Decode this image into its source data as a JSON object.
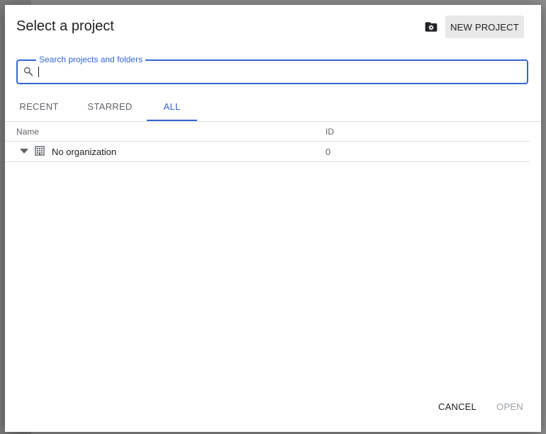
{
  "dialog": {
    "title": "Select a project",
    "new_project_label": "NEW PROJECT"
  },
  "search": {
    "label": "Search projects and folders",
    "value": ""
  },
  "tabs": [
    {
      "label": "RECENT",
      "active": false
    },
    {
      "label": "STARRED",
      "active": false
    },
    {
      "label": "ALL",
      "active": true
    }
  ],
  "table": {
    "columns": [
      "Name",
      "ID"
    ],
    "rows": [
      {
        "name": "No organization",
        "id": "0",
        "icon": "organization-icon",
        "expand_icon": "caret-down-icon"
      }
    ]
  },
  "footer": {
    "cancel_label": "CANCEL",
    "open_label": "OPEN"
  },
  "colors": {
    "accent": "#3367d6",
    "button_bg": "#e8e8e8",
    "disabled_text": "#9aa0a6"
  }
}
